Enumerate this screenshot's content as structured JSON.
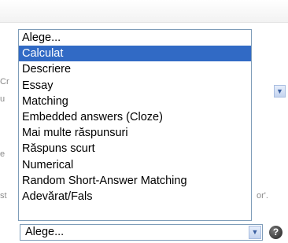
{
  "background": {
    "fragments": [
      {
        "name": "bg-text-cr",
        "text": "Cr"
      },
      {
        "name": "bg-text-u",
        "text": "u"
      },
      {
        "name": "bg-text-e",
        "text": "e"
      },
      {
        "name": "bg-text-st",
        "text": "st"
      },
      {
        "name": "bg-text-or",
        "text": "or'."
      }
    ]
  },
  "question_type_list": {
    "options": [
      "Alege...",
      "Calculat",
      "Descriere",
      "Essay",
      "Matching",
      "Embedded answers (Cloze)",
      "Mai multe răspunsuri",
      "Răspuns scurt",
      "Numerical",
      "Random Short-Answer Matching",
      "Adevărat/Fals"
    ],
    "highlighted": "Calculat"
  },
  "question_type_select": {
    "value": "Alege...",
    "arrow_icon": "chevron-down-icon"
  },
  "help": {
    "icon": "help-icon",
    "symbol": "?"
  },
  "colors": {
    "selection": "#316ac5",
    "border": "#7f9db9"
  }
}
